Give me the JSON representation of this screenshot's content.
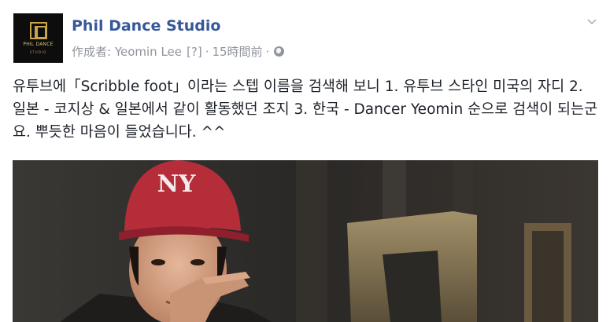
{
  "post": {
    "page_name": "Phil Dance Studio",
    "author_label": "作成者: Yeomin Lee",
    "help_marker": "[?]",
    "time": "15時間前",
    "dot": "·",
    "privacy_icon": "globe-icon",
    "menu_icon": "chevron-down-icon",
    "body": "유투브에「Scribble foot」이라는 스텝 이름을 검색해 보니 1. 유투브 스타인 미국의 자디 2. 일본 - 코지상 & 일본에서 같이 활동했던 조지 3. 한국 - Dancer Yeomin 순으로 검색이 되는군요. 뿌듯한 마음이 들었습니다. ^^"
  },
  "logo": {
    "text": "PHIL DANCE",
    "sub": "STUDIO",
    "accent": "#c9a54a"
  },
  "media": {
    "cap_logo": "NY",
    "description_colors": {
      "cap": "#b62d3a",
      "background": "#2e2c28",
      "metal": "#8a7a5a"
    }
  },
  "colors": {
    "link": "#365899",
    "meta": "#90949c",
    "text": "#1d2129"
  }
}
